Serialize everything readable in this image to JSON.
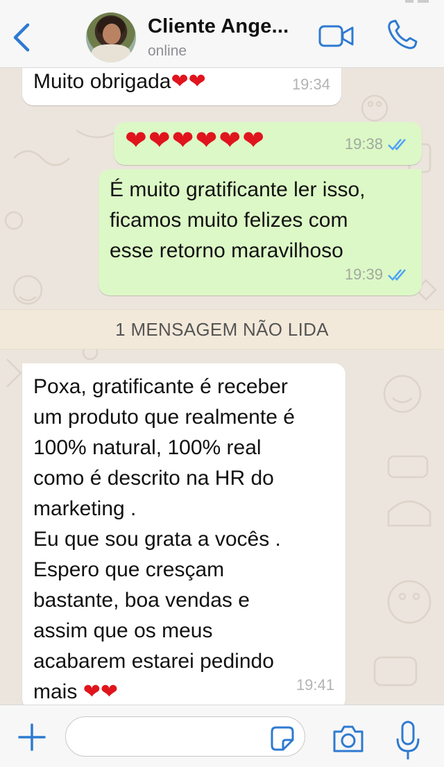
{
  "header": {
    "contact_name": "Cliente Ange...",
    "status": "online"
  },
  "messages": [
    {
      "direction": "in",
      "text": "Muito obrigada",
      "hearts": "❤❤",
      "time": "19:34"
    },
    {
      "direction": "out",
      "text": "",
      "hearts": "❤❤❤❤❤❤",
      "time": "19:38",
      "read": true
    },
    {
      "direction": "out",
      "text": "É muito gratificante ler isso,\nficamos muito felizes com\nesse retorno maravilhoso",
      "time": "19:39",
      "read": true
    },
    {
      "direction": "in",
      "text": "Poxa, gratificante é receber\num produto que realmente é\n100% natural, 100% real\ncomo é descrito na HR do\nmarketing .\nEu que sou grata a vocês .\nEspero que cresçam\nbastante, boa vendas e\nassim que os meus\nacabarem estarei pedindo\nmais ",
      "hearts": "❤❤",
      "time": "19:41"
    }
  ],
  "unread_banner": "1 MENSAGEM NÃO LIDA",
  "composer": {
    "placeholder": ""
  },
  "colors": {
    "accent": "#2e7ad1",
    "outgoing_bubble": "#dcf8c6",
    "incoming_bubble": "#ffffff",
    "read_ticks": "#4fa3f7",
    "heart": "#e0141d"
  }
}
